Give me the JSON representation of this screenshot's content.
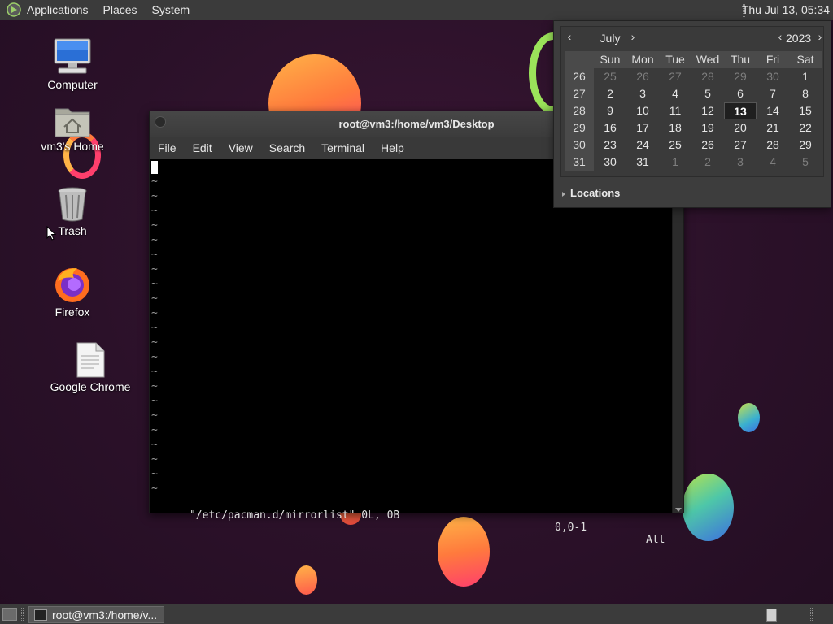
{
  "top_panel": {
    "menus": [
      "Applications",
      "Places",
      "System"
    ],
    "clock": "Thu Jul 13, 05:34"
  },
  "desktop_icons": [
    {
      "label": "Computer",
      "icon": "computer-icon"
    },
    {
      "label": "vm3's Home",
      "icon": "home-folder-icon"
    },
    {
      "label": "Trash",
      "icon": "trash-icon"
    },
    {
      "label": "Firefox",
      "icon": "firefox-icon"
    },
    {
      "label": "Google Chrome",
      "icon": "document-icon"
    }
  ],
  "terminal": {
    "title": "root@vm3:/home/vm3/Desktop",
    "menu": [
      "File",
      "Edit",
      "View",
      "Search",
      "Terminal",
      "Help"
    ],
    "tildes": "~\n~\n~\n~\n~\n~\n~\n~\n~\n~\n~\n~\n~\n~\n~\n~\n~\n~\n~\n~\n~\n~",
    "status_file": "\"/etc/pacman.d/mirrorlist\" 0L, 0B",
    "status_pos": "0,0-1",
    "status_all": "All"
  },
  "calendar": {
    "month": "July",
    "year": "2023",
    "prev_month": "‹",
    "next_month": "›",
    "prev_year": "‹",
    "next_year": "›",
    "weekdays": [
      "Sun",
      "Mon",
      "Tue",
      "Wed",
      "Thu",
      "Fri",
      "Sat"
    ],
    "weeks": [
      {
        "wk": "26",
        "days": [
          "25",
          "26",
          "27",
          "28",
          "29",
          "30",
          "1"
        ]
      },
      {
        "wk": "27",
        "days": [
          "2",
          "3",
          "4",
          "5",
          "6",
          "7",
          "8"
        ]
      },
      {
        "wk": "28",
        "days": [
          "9",
          "10",
          "11",
          "12",
          "13",
          "14",
          "15"
        ]
      },
      {
        "wk": "29",
        "days": [
          "16",
          "17",
          "18",
          "19",
          "20",
          "21",
          "22"
        ]
      },
      {
        "wk": "30",
        "days": [
          "23",
          "24",
          "25",
          "26",
          "27",
          "28",
          "29"
        ]
      },
      {
        "wk": "31",
        "days": [
          "30",
          "31",
          "1",
          "2",
          "3",
          "4",
          "5"
        ]
      }
    ],
    "today": "13",
    "locations_label": "Locations"
  },
  "bottom_panel": {
    "task_label": "root@vm3:/home/v..."
  },
  "colors": {
    "panel": "#3b3b3b",
    "terminal_bg": "#000000",
    "wallpaper": "#2b1129"
  }
}
